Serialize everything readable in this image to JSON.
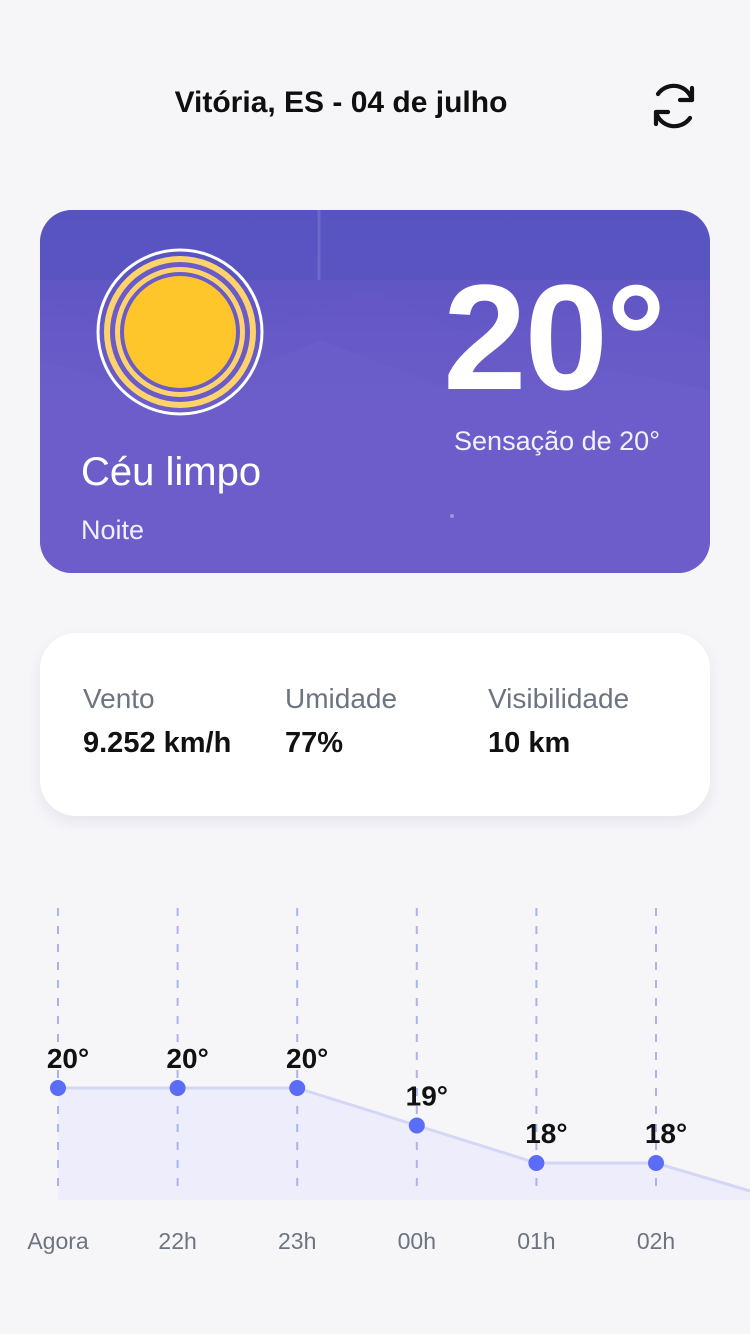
{
  "header": {
    "title": "Vitória, ES - 04 de julho",
    "refresh_icon": "refresh-icon"
  },
  "current": {
    "icon": "sun-icon",
    "condition": "Céu limpo",
    "period": "Noite",
    "temperature": "20°",
    "feels_like": "Sensação de 20°",
    "colors": {
      "card": "#6a5bc8",
      "sun": "#ffc62b"
    }
  },
  "details": {
    "wind": {
      "label": "Vento",
      "value": "9.252 km/h"
    },
    "humidity": {
      "label": "Umidade",
      "value": "77%"
    },
    "visibility": {
      "label": "Visibilidade",
      "value": "10 km"
    }
  },
  "hourly": {
    "accent": "#5b6cf6",
    "hours": [
      {
        "time": "Agora",
        "temp": 20,
        "label": "20°"
      },
      {
        "time": "22h",
        "temp": 20,
        "label": "20°"
      },
      {
        "time": "23h",
        "temp": 20,
        "label": "20°"
      },
      {
        "time": "00h",
        "temp": 19,
        "label": "19°"
      },
      {
        "time": "01h",
        "temp": 18,
        "label": "18°"
      },
      {
        "time": "02h",
        "temp": 18,
        "label": "18°"
      }
    ]
  }
}
